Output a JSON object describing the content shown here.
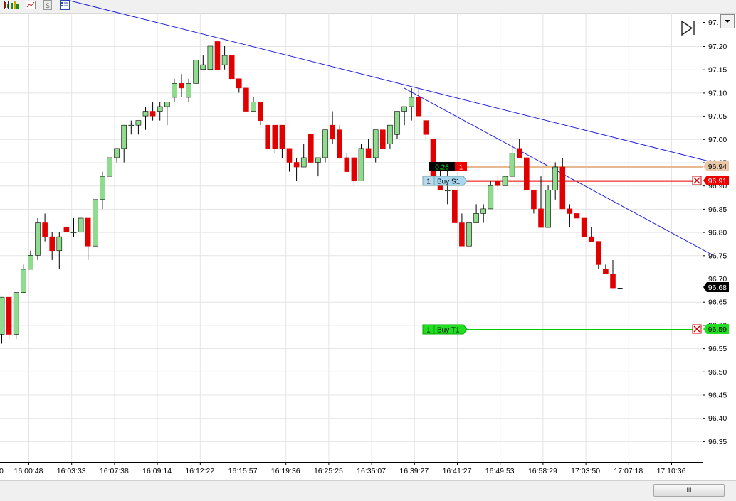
{
  "toolbar": {
    "buttons": [
      "candlestick-chart-icon",
      "bar-chart-icon",
      "indicator-icon",
      "dollar-icon",
      "properties-icon"
    ]
  },
  "colors": {
    "up": "#8fdc8f",
    "down": "#e00000",
    "trendline": "#2222dd",
    "grid": "#e4e4e4",
    "stop_line": "#ee0000",
    "target_line": "#00cc00",
    "avg_line": "#e8b890"
  },
  "y_axis": {
    "labels": [
      "97.20",
      "97.15",
      "97.10",
      "97.05",
      "97.00",
      "96.95",
      "96.90",
      "96.85",
      "96.80",
      "96.75",
      "96.70",
      "96.65",
      "96.60",
      "96.55",
      "96.50",
      "96.45",
      "96.40",
      "96.35"
    ],
    "top_partial": "97.",
    "last_price": "96.68",
    "avg_price": "96.94",
    "stop_price": "96.91",
    "target_price": "96.59"
  },
  "x_axis": {
    "labels": [
      "16:00:48",
      "16:03:33",
      "16:07:38",
      "16:09:14",
      "16:12:22",
      "16:15:57",
      "16:19:36",
      "16:25:25",
      "16:35:07",
      "16:39:27",
      "16:41:27",
      "16:49:53",
      "16:58:29",
      "17:03:50",
      "17:07:18",
      "17:10:36"
    ],
    "left_partial": "0"
  },
  "orders": {
    "position": {
      "pnl": "0.26",
      "qty": "1"
    },
    "stop": {
      "qty": "1",
      "label": "Buy S1"
    },
    "target": {
      "qty": "1",
      "label": "Buy T1"
    }
  },
  "scrollbar": {
    "thumb_label": "III"
  },
  "chart_data": {
    "type": "candlestick",
    "ylim": [
      96.3,
      97.22
    ],
    "grid": true,
    "candles": [
      {
        "o": 96.58,
        "h": 96.66,
        "l": 96.56,
        "c": 96.66
      },
      {
        "o": 96.66,
        "h": 96.66,
        "l": 96.57,
        "c": 96.58
      },
      {
        "o": 96.58,
        "h": 96.67,
        "l": 96.57,
        "c": 96.67
      },
      {
        "o": 96.67,
        "h": 96.73,
        "l": 96.67,
        "c": 96.72
      },
      {
        "o": 96.72,
        "h": 96.76,
        "l": 96.72,
        "c": 96.75
      },
      {
        "o": 96.75,
        "h": 96.83,
        "l": 96.74,
        "c": 96.82
      },
      {
        "o": 96.82,
        "h": 96.84,
        "l": 96.78,
        "c": 96.79
      },
      {
        "o": 96.79,
        "h": 96.8,
        "l": 96.74,
        "c": 96.76
      },
      {
        "o": 96.76,
        "h": 96.8,
        "l": 96.72,
        "c": 96.79
      },
      {
        "o": 96.81,
        "h": 96.81,
        "l": 96.8,
        "c": 96.8
      },
      {
        "o": 96.8,
        "h": 96.83,
        "l": 96.79,
        "c": 96.8
      },
      {
        "o": 96.8,
        "h": 96.83,
        "l": 96.8,
        "c": 96.83
      },
      {
        "o": 96.83,
        "h": 96.83,
        "l": 96.74,
        "c": 96.77
      },
      {
        "o": 96.77,
        "h": 96.87,
        "l": 96.77,
        "c": 96.87
      },
      {
        "o": 96.87,
        "h": 96.93,
        "l": 96.85,
        "c": 96.92
      },
      {
        "o": 96.92,
        "h": 96.96,
        "l": 96.92,
        "c": 96.96
      },
      {
        "o": 96.96,
        "h": 96.98,
        "l": 96.95,
        "c": 96.98
      },
      {
        "o": 96.98,
        "h": 97.03,
        "l": 96.95,
        "c": 97.03
      },
      {
        "o": 97.03,
        "h": 97.04,
        "l": 97.01,
        "c": 97.03
      },
      {
        "o": 97.03,
        "h": 97.04,
        "l": 97.01,
        "c": 97.04
      },
      {
        "o": 97.05,
        "h": 97.07,
        "l": 97.02,
        "c": 97.06
      },
      {
        "o": 97.06,
        "h": 97.08,
        "l": 97.04,
        "c": 97.05
      },
      {
        "o": 97.06,
        "h": 97.08,
        "l": 97.04,
        "c": 97.07
      },
      {
        "o": 97.07,
        "h": 97.08,
        "l": 97.03,
        "c": 97.08
      },
      {
        "o": 97.09,
        "h": 97.13,
        "l": 97.08,
        "c": 97.12
      },
      {
        "o": 97.12,
        "h": 97.14,
        "l": 97.09,
        "c": 97.11
      },
      {
        "o": 97.09,
        "h": 97.13,
        "l": 97.08,
        "c": 97.12
      },
      {
        "o": 97.12,
        "h": 97.17,
        "l": 97.12,
        "c": 97.17
      },
      {
        "o": 97.15,
        "h": 97.18,
        "l": 97.15,
        "c": 97.16
      },
      {
        "o": 97.15,
        "h": 97.2,
        "l": 97.15,
        "c": 97.2
      },
      {
        "o": 97.21,
        "h": 97.21,
        "l": 97.15,
        "c": 97.15
      },
      {
        "o": 97.16,
        "h": 97.2,
        "l": 97.15,
        "c": 97.18
      },
      {
        "o": 97.18,
        "h": 97.18,
        "l": 97.13,
        "c": 97.13
      },
      {
        "o": 97.13,
        "h": 97.13,
        "l": 97.1,
        "c": 97.11
      },
      {
        "o": 97.11,
        "h": 97.11,
        "l": 97.06,
        "c": 97.06
      },
      {
        "o": 97.06,
        "h": 97.09,
        "l": 97.06,
        "c": 97.08
      },
      {
        "o": 97.08,
        "h": 97.08,
        "l": 97.03,
        "c": 97.04
      },
      {
        "o": 97.03,
        "h": 97.03,
        "l": 96.98,
        "c": 96.98
      },
      {
        "o": 97.03,
        "h": 97.03,
        "l": 96.97,
        "c": 96.98
      },
      {
        "o": 97.03,
        "h": 97.03,
        "l": 96.96,
        "c": 96.98
      },
      {
        "o": 96.98,
        "h": 96.98,
        "l": 96.93,
        "c": 96.95
      },
      {
        "o": 96.95,
        "h": 96.96,
        "l": 96.91,
        "c": 96.94
      },
      {
        "o": 96.94,
        "h": 96.99,
        "l": 96.94,
        "c": 96.96
      },
      {
        "o": 97.01,
        "h": 97.01,
        "l": 96.95,
        "c": 96.95
      },
      {
        "o": 96.95,
        "h": 96.96,
        "l": 96.92,
        "c": 96.96
      },
      {
        "o": 96.96,
        "h": 97.02,
        "l": 96.95,
        "c": 97.02
      },
      {
        "o": 97.03,
        "h": 97.06,
        "l": 96.99,
        "c": 97.0
      },
      {
        "o": 97.02,
        "h": 97.03,
        "l": 96.96,
        "c": 96.96
      },
      {
        "o": 96.96,
        "h": 96.97,
        "l": 96.93,
        "c": 96.93
      },
      {
        "o": 96.96,
        "h": 96.96,
        "l": 96.9,
        "c": 96.91
      },
      {
        "o": 96.91,
        "h": 96.99,
        "l": 96.91,
        "c": 96.98
      },
      {
        "o": 96.98,
        "h": 97.0,
        "l": 96.96,
        "c": 96.96
      },
      {
        "o": 96.96,
        "h": 97.02,
        "l": 96.95,
        "c": 97.02
      },
      {
        "o": 97.02,
        "h": 97.02,
        "l": 96.98,
        "c": 96.98
      },
      {
        "o": 96.99,
        "h": 97.03,
        "l": 96.98,
        "c": 97.03
      },
      {
        "o": 97.01,
        "h": 97.06,
        "l": 97.0,
        "c": 97.06
      },
      {
        "o": 97.06,
        "h": 97.07,
        "l": 97.03,
        "c": 97.07
      },
      {
        "o": 97.07,
        "h": 97.11,
        "l": 97.04,
        "c": 97.09
      },
      {
        "o": 97.09,
        "h": 97.11,
        "l": 97.05,
        "c": 97.05
      },
      {
        "o": 97.04,
        "h": 97.04,
        "l": 97.0,
        "c": 97.01
      },
      {
        "o": 97.0,
        "h": 97.0,
        "l": 96.9,
        "c": 96.91
      },
      {
        "o": 96.91,
        "h": 96.95,
        "l": 96.89,
        "c": 96.89
      },
      {
        "o": 96.89,
        "h": 96.94,
        "l": 96.86,
        "c": 96.89
      },
      {
        "o": 96.89,
        "h": 96.89,
        "l": 96.82,
        "c": 96.82
      },
      {
        "o": 96.82,
        "h": 96.84,
        "l": 96.77,
        "c": 96.77
      },
      {
        "o": 96.77,
        "h": 96.82,
        "l": 96.77,
        "c": 96.82
      },
      {
        "o": 96.82,
        "h": 96.86,
        "l": 96.82,
        "c": 96.84
      },
      {
        "o": 96.84,
        "h": 96.86,
        "l": 96.82,
        "c": 96.85
      },
      {
        "o": 96.85,
        "h": 96.91,
        "l": 96.85,
        "c": 96.9
      },
      {
        "o": 96.91,
        "h": 96.92,
        "l": 96.89,
        "c": 96.9
      },
      {
        "o": 96.9,
        "h": 96.95,
        "l": 96.89,
        "c": 96.92
      },
      {
        "o": 96.92,
        "h": 96.99,
        "l": 96.92,
        "c": 96.97
      },
      {
        "o": 96.98,
        "h": 97.0,
        "l": 96.96,
        "c": 96.96
      },
      {
        "o": 96.96,
        "h": 96.96,
        "l": 96.89,
        "c": 96.89
      },
      {
        "o": 96.89,
        "h": 96.89,
        "l": 96.84,
        "c": 96.85
      },
      {
        "o": 96.85,
        "h": 96.92,
        "l": 96.81,
        "c": 96.81
      },
      {
        "o": 96.81,
        "h": 96.9,
        "l": 96.81,
        "c": 96.89
      },
      {
        "o": 96.89,
        "h": 96.95,
        "l": 96.87,
        "c": 96.94
      },
      {
        "o": 96.94,
        "h": 96.96,
        "l": 96.85,
        "c": 96.85
      },
      {
        "o": 96.85,
        "h": 96.86,
        "l": 96.81,
        "c": 96.84
      },
      {
        "o": 96.84,
        "h": 96.84,
        "l": 96.83,
        "c": 96.83
      },
      {
        "o": 96.83,
        "h": 96.83,
        "l": 96.79,
        "c": 96.79
      },
      {
        "o": 96.79,
        "h": 96.81,
        "l": 96.78,
        "c": 96.78
      },
      {
        "o": 96.78,
        "h": 96.78,
        "l": 96.72,
        "c": 96.73
      },
      {
        "o": 96.72,
        "h": 96.73,
        "l": 96.71,
        "c": 96.71
      },
      {
        "o": 96.71,
        "h": 96.74,
        "l": 96.68,
        "c": 96.68
      },
      {
        "o": 96.68,
        "h": 96.68,
        "l": 96.68,
        "c": 96.68
      }
    ],
    "trendlines": [
      {
        "from": [
          0,
          97.335
        ],
        "to": [
          99,
          96.95
        ]
      },
      {
        "from": [
          56,
          97.11
        ],
        "to": [
          99,
          96.75
        ]
      }
    ],
    "price_lines": {
      "avg": 96.94,
      "stop": 96.91,
      "target": 96.59
    }
  }
}
